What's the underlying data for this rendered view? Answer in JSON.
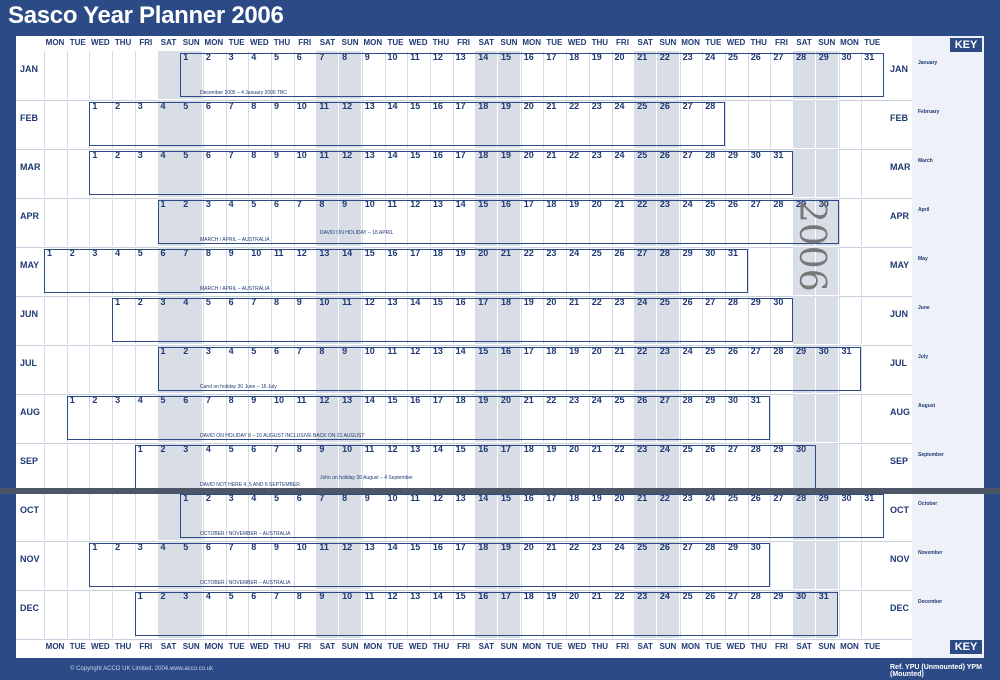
{
  "title": "Sasco Year Planner 2006",
  "key_label": "KEY",
  "day_names": [
    "MON",
    "TUE",
    "WED",
    "THU",
    "FRI",
    "SAT",
    "SUN",
    "MON",
    "TUE",
    "WED",
    "THU",
    "FRI",
    "SAT",
    "SUN",
    "MON",
    "TUE",
    "WED",
    "THU",
    "FRI",
    "SAT",
    "SUN",
    "MON",
    "TUE",
    "WED",
    "THU",
    "FRI",
    "SAT",
    "SUN",
    "MON",
    "TUE",
    "WED",
    "THU",
    "FRI",
    "SAT",
    "SUN",
    "MON",
    "TUE"
  ],
  "months": [
    {
      "label": "JAN",
      "start": 6,
      "days": 31
    },
    {
      "label": "FEB",
      "start": 2,
      "days": 28
    },
    {
      "label": "MAR",
      "start": 2,
      "days": 31
    },
    {
      "label": "APR",
      "start": 5,
      "days": 30
    },
    {
      "label": "MAY",
      "start": 0,
      "days": 31
    },
    {
      "label": "JUN",
      "start": 3,
      "days": 30
    },
    {
      "label": "JUL",
      "start": 5,
      "days": 31
    },
    {
      "label": "AUG",
      "start": 1,
      "days": 31
    },
    {
      "label": "SEP",
      "start": 4,
      "days": 30
    },
    {
      "label": "OCT",
      "start": 6,
      "days": 31
    },
    {
      "label": "NOV",
      "start": 2,
      "days": 30
    },
    {
      "label": "DEC",
      "start": 4,
      "days": 31
    }
  ],
  "banners": [
    {
      "row": 0,
      "text": "December 2005 – 4 January 2006 TBC"
    },
    {
      "row": 3,
      "text": "MARCH / APRIL – AUSTRALIA"
    },
    {
      "row": 3,
      "text": "DAVID ON HOLIDAY – 18 APRIL"
    },
    {
      "row": 4,
      "text": "MARCH / APRIL – AUSTRALIA"
    },
    {
      "row": 6,
      "text": "Carol on holiday 30 June – 16 July"
    },
    {
      "row": 7,
      "text": "DAVID ON HOLIDAY 8 – 16 AUGUST     INCLUSIVE BACK ON 21 AUGUST"
    },
    {
      "row": 8,
      "text": "DAVID NOT HERE 4, 5 AND 6 SEPTEMBER"
    },
    {
      "row": 8,
      "text": "John on holiday 30 August – 4 September"
    },
    {
      "row": 9,
      "text": "OCTOBER / NOVEMBER – AUSTRALIA"
    },
    {
      "row": 10,
      "text": "OCTOBER / NOVEMBER – AUSTRALIA"
    }
  ],
  "mini_calendars": [
    "January",
    "February",
    "March",
    "April",
    "May",
    "June",
    "July",
    "August",
    "September",
    "October",
    "November",
    "December"
  ],
  "scrawl": "2006",
  "footer": {
    "copyright": "© Copyright ACCO UK Limited, 2004.",
    "website": "www.acco.co.uk",
    "ref": "Ref. YPU (Unmounted)  YPM (Mounted)"
  }
}
